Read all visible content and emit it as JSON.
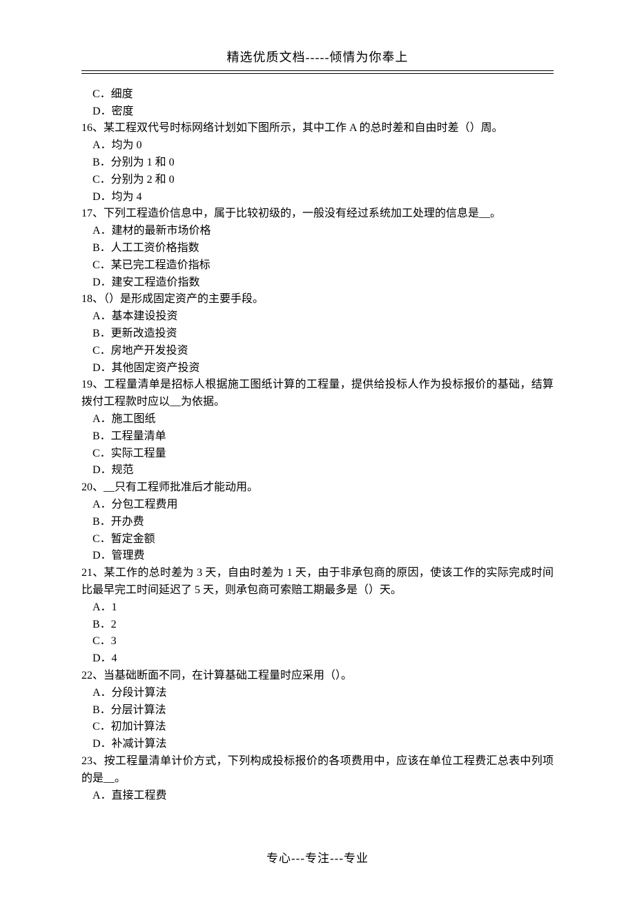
{
  "header": "精选优质文档-----倾情为你奉上",
  "footer": "专心---专注---专业",
  "lines": {
    "opt15c": "C．细度",
    "opt15d": "D．密度",
    "q16": "16、某工程双代号时标网络计划如下图所示，其中工作 A 的总时差和自由时差（）周。",
    "q16a": "A．均为 0",
    "q16b": "B．分别为 1 和 0",
    "q16c": "C．分别为 2 和 0",
    "q16d": "D．均为 4",
    "q17": "17、下列工程造价信息中，属于比较初级的，一般没有经过系统加工处理的信息是__。",
    "q17a": "A．建材的最新市场价格",
    "q17b": "B．人工工资价格指数",
    "q17c": "C．某已完工程造价指标",
    "q17d": "D．建安工程造价指数",
    "q18": "18、（）是形成固定资产的主要手段。",
    "q18a": "A．基本建设投资",
    "q18b": "B．更新改造投资",
    "q18c": "C．房地产开发投资",
    "q18d": "D．其他固定资产投资",
    "q19": "19、工程量清单是招标人根据施工图纸计算的工程量，提供给投标人作为投标报价的基础，结算拨付工程款时应以__为依据。",
    "q19a": "A．施工图纸",
    "q19b": "B．工程量清单",
    "q19c": "C．实际工程量",
    "q19d": "D．规范",
    "q20": "20、__只有工程师批准后才能动用。",
    "q20a": "A．分包工程费用",
    "q20b": "B．开办费",
    "q20c": "C．暂定金额",
    "q20d": "D．管理费",
    "q21": "21、某工作的总时差为 3 天，自由时差为 1 天，由于非承包商的原因，使该工作的实际完成时间比最早完工时间延迟了 5 天，则承包商可索赔工期最多是（）天。",
    "q21a": "A．1",
    "q21b": "B．2",
    "q21c": "C．3",
    "q21d": "D．4",
    "q22": "22、当基础断面不同，在计算基础工程量时应采用（）。",
    "q22a": "A．分段计算法",
    "q22b": "B．分层计算法",
    "q22c": "C．初加计算法",
    "q22d": "D．补减计算法",
    "q23": "23、按工程量清单计价方式，下列构成投标报价的各项费用中，应该在单位工程费汇总表中列项的是__。",
    "q23a": "A．直接工程费"
  }
}
